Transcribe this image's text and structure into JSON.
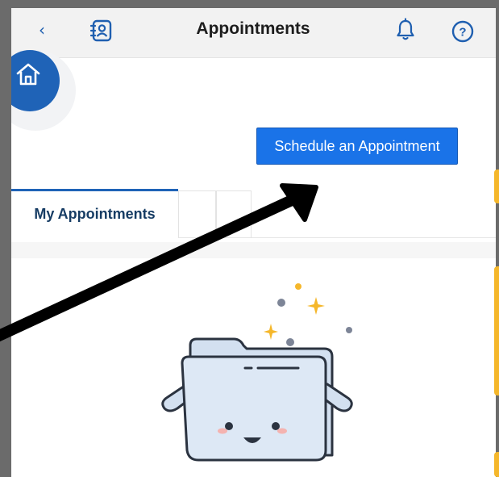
{
  "header": {
    "title": "Appointments",
    "back_icon": "chevron-left-icon",
    "contacts_icon": "address-book-icon",
    "notifications_icon": "bell-icon",
    "help_icon": "help-circle-icon"
  },
  "home": {
    "icon": "home-icon"
  },
  "actions": {
    "schedule_label": "Schedule an Appointment"
  },
  "tabs": [
    {
      "label": "My Appointments",
      "active": true
    },
    {
      "label": "",
      "active": false
    },
    {
      "label": "",
      "active": false
    }
  ],
  "empty_state": {
    "illustration": "empty-folder-illustration"
  },
  "colors": {
    "primary": "#1f63b7",
    "button": "#1a73e8",
    "accent": "#f5b72b",
    "tab_text": "#163c64"
  }
}
